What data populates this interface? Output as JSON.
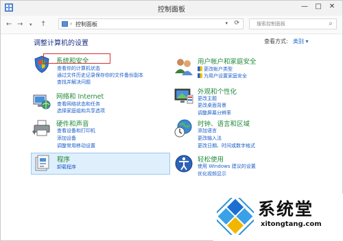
{
  "window": {
    "title": "控制面板"
  },
  "address": {
    "path": "控制面板",
    "search_placeholder": "搜索控制面板"
  },
  "main": {
    "heading": "调整计算机的设置",
    "view_by_label": "查看方式:",
    "view_by_value": "类别"
  },
  "categories": [
    {
      "title": "系统和安全",
      "icon": "shield-flag-icon",
      "links": [
        "查看你的计算机状态",
        "通过文件历史记录保存你的文件备份副本",
        "查找并解决问题"
      ]
    },
    {
      "title": "网络和 Internet",
      "icon": "network-globe-icon",
      "links": [
        "查看网络状态和任务",
        "选择家庭组和共享选项"
      ]
    },
    {
      "title": "硬件和声音",
      "icon": "printer-icon",
      "links": [
        "查看设备和打印机",
        "添加设备",
        "调整常用移动设置"
      ]
    },
    {
      "title": "程序",
      "icon": "programs-icon",
      "links": [
        "卸载程序"
      ]
    },
    {
      "title": "用户帐户和家庭安全",
      "icon": "users-icon",
      "links": [
        "更改帐户类型",
        "为用户设置家庭安全"
      ]
    },
    {
      "title": "外观和个性化",
      "icon": "monitor-icon",
      "links": [
        "更改主题",
        "更改桌面背景",
        "调整屏幕分辨率"
      ]
    },
    {
      "title": "时钟、语言和区域",
      "icon": "clock-globe-icon",
      "links": [
        "添加语言",
        "更改输入法",
        "更改日期、时间或数字格式"
      ]
    },
    {
      "title": "轻松使用",
      "icon": "ease-of-access-icon",
      "links": [
        "使用 Windows 建议的设置",
        "优化视频显示"
      ]
    }
  ],
  "watermark": {
    "name": "系统堂",
    "url": "xitongtang.com"
  },
  "colors": {
    "category_title": "#1f8a3a",
    "link": "#1a5dc8",
    "heading": "#1e3287",
    "highlight_box": "#d62b2b",
    "selected_bg": "#dfeffc"
  }
}
